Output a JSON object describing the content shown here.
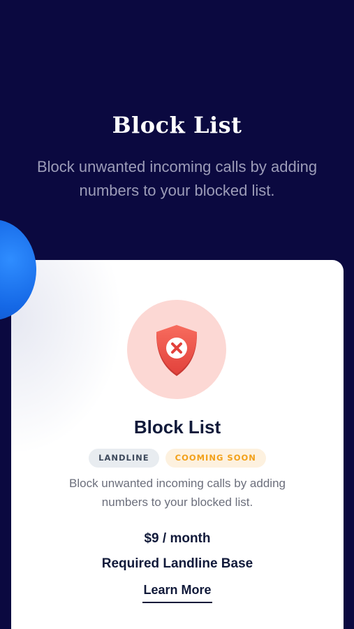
{
  "hero": {
    "title": "Block List",
    "subtitle": "Block unwanted incoming calls by adding numbers to your blocked list."
  },
  "card": {
    "icon": "shield-block-icon",
    "title": "Block List",
    "tags": [
      {
        "label": "LANDLINE"
      },
      {
        "label": "COOMING SOON"
      }
    ],
    "description": "Block unwanted incoming calls by adding numbers to your blocked list.",
    "price": "$9 / month",
    "requirement": "Required Landline Base",
    "cta_label": "Learn More"
  },
  "colors": {
    "background": "#0b0940",
    "card_background": "#ffffff",
    "accent_blue": "#1568e6",
    "shield_red": "#f05a4f",
    "icon_circle": "#fcd8d4",
    "tag_landline_bg": "#e8ecf0",
    "tag_soon_bg": "#fdf1df",
    "tag_soon_text": "#f2a11a"
  }
}
